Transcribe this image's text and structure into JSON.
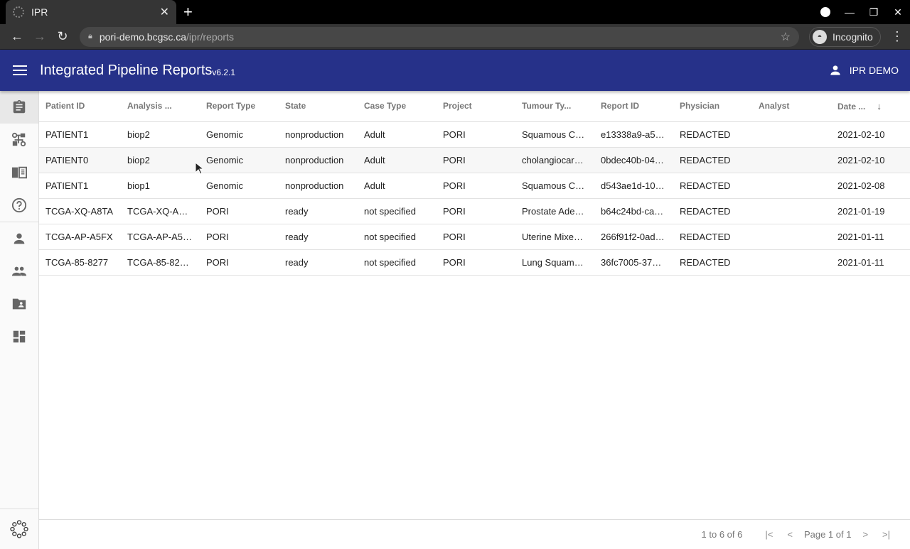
{
  "browser": {
    "tab_title": "IPR",
    "url_host": "pori-demo.bcgsc.ca",
    "url_path": "/ipr/reports",
    "incognito_label": "Incognito"
  },
  "appbar": {
    "title": "Integrated Pipeline Reports",
    "version": "v6.2.1",
    "user_label": "IPR DEMO"
  },
  "sidebar": {
    "items": [
      {
        "name": "reports",
        "icon": "clipboard-icon",
        "active": true
      },
      {
        "name": "germline",
        "icon": "hierarchy-icon"
      },
      {
        "name": "docs",
        "icon": "book-icon"
      },
      {
        "name": "help",
        "icon": "help-circle-icon"
      },
      {
        "name": "users",
        "icon": "person-icon"
      },
      {
        "name": "groups",
        "icon": "people-icon"
      },
      {
        "name": "projects",
        "icon": "folder-user-icon"
      },
      {
        "name": "templates",
        "icon": "dashboard-icon"
      }
    ],
    "bottom_icon": "pori-logo-icon"
  },
  "table": {
    "columns": [
      "Patient ID",
      "Analysis ...",
      "Report Type",
      "State",
      "Case Type",
      "Project",
      "Tumour Ty...",
      "Report ID",
      "Physician",
      "Analyst",
      "Date ..."
    ],
    "sorted_column": "Date ...",
    "sort_direction": "descending",
    "rows": [
      [
        "PATIENT1",
        "biop2",
        "Genomic",
        "nonproduction",
        "Adult",
        "PORI",
        "Squamous C…",
        "e13338a9-a5…",
        "REDACTED",
        "",
        "2021-02-10"
      ],
      [
        "PATIENT0",
        "biop2",
        "Genomic",
        "nonproduction",
        "Adult",
        "PORI",
        "cholangiocar…",
        "0bdec40b-04…",
        "REDACTED",
        "",
        "2021-02-10"
      ],
      [
        "PATIENT1",
        "biop1",
        "Genomic",
        "nonproduction",
        "Adult",
        "PORI",
        "Squamous C…",
        "d543ae1d-10…",
        "REDACTED",
        "",
        "2021-02-08"
      ],
      [
        "TCGA-XQ-A8TA",
        "TCGA-XQ-A…",
        "PORI",
        "ready",
        "not specified",
        "PORI",
        "Prostate Ade…",
        "b64c24bd-ca…",
        "REDACTED",
        "",
        "2021-01-19"
      ],
      [
        "TCGA-AP-A5FX",
        "TCGA-AP-A5…",
        "PORI",
        "ready",
        "not specified",
        "PORI",
        "Uterine Mixe…",
        "266f91f2-0ad…",
        "REDACTED",
        "",
        "2021-01-11"
      ],
      [
        "TCGA-85-8277",
        "TCGA-85-82…",
        "PORI",
        "ready",
        "not specified",
        "PORI",
        "Lung Squam…",
        "36fc7005-37…",
        "REDACTED",
        "",
        "2021-01-11"
      ]
    ]
  },
  "pagination": {
    "range": "1 to 6 of 6",
    "page_label": "Page 1 of 1"
  }
}
